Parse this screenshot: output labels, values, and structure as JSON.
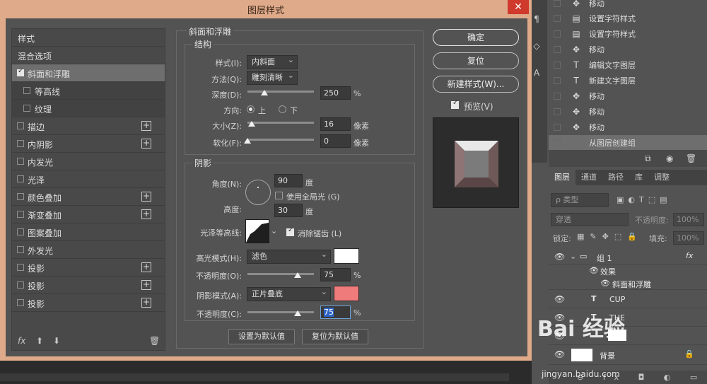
{
  "dialog": {
    "title": "图层样式",
    "close_glyph": "✕"
  },
  "style_list": {
    "header": "样式",
    "blend": "混合选项",
    "items": [
      {
        "label": "斜面和浮雕",
        "checked": true,
        "active": true,
        "plus": false,
        "indent": false
      },
      {
        "label": "等高线",
        "checked": false,
        "active": false,
        "plus": false,
        "indent": true
      },
      {
        "label": "纹理",
        "checked": false,
        "active": false,
        "plus": false,
        "indent": true
      },
      {
        "label": "描边",
        "checked": false,
        "plus": true
      },
      {
        "label": "内阴影",
        "checked": false,
        "plus": true
      },
      {
        "label": "内发光",
        "checked": false,
        "plus": false
      },
      {
        "label": "光泽",
        "checked": false,
        "plus": false
      },
      {
        "label": "颜色叠加",
        "checked": false,
        "plus": true
      },
      {
        "label": "渐变叠加",
        "checked": false,
        "plus": true
      },
      {
        "label": "图案叠加",
        "checked": false,
        "plus": false
      },
      {
        "label": "外发光",
        "checked": false,
        "plus": false
      },
      {
        "label": "投影",
        "checked": false,
        "plus": true
      },
      {
        "label": "投影",
        "checked": false,
        "plus": true
      },
      {
        "label": "投影",
        "checked": false,
        "plus": true
      }
    ],
    "plus_glyph": "+",
    "bottom": {
      "fx": "fx",
      "up": "⬆",
      "down": "⬇",
      "trash": "🗑"
    }
  },
  "bevel": {
    "section": "斜面和浮雕",
    "structure": "结构",
    "style_label": "样式(I):",
    "style_value": "内斜面",
    "technique_label": "方法(Q):",
    "technique_value": "雕刻清晰",
    "depth_label": "深度(D):",
    "depth_value": "250",
    "depth_unit": "%",
    "depth_fraction": 0.25,
    "direction_label": "方向:",
    "dir_up": "上",
    "dir_down": "下",
    "size_label": "大小(Z):",
    "size_value": "16",
    "size_unit": "像素",
    "size_fraction": 0.06,
    "soften_label": "软化(F):",
    "soften_value": "0",
    "soften_unit": "像素",
    "soften_fraction": 0.0
  },
  "shading": {
    "section": "阴影",
    "angle_label": "角度(N):",
    "angle_value": "90",
    "angle_unit": "度",
    "global_light": "使用全局光 (G)",
    "altitude_label": "高度:",
    "altitude_value": "30",
    "altitude_unit": "度",
    "gloss_label": "光泽等高线:",
    "antialias": "消除锯齿 (L)",
    "highlight_label": "高光模式(H):",
    "highlight_value": "滤色",
    "highlight_color": "#ffffff",
    "hl_opacity_label": "不透明度(O):",
    "hl_opacity_value": "75",
    "hl_opacity_fraction": 0.75,
    "shadow_label": "阴影模式(A):",
    "shadow_value": "正片叠底",
    "shadow_color": "#f07b7b",
    "sh_opacity_label": "不透明度(C):",
    "sh_opacity_value": "75",
    "sh_opacity_fraction": 0.75,
    "pct": "%"
  },
  "defaults": {
    "set": "设置为默认值",
    "reset": "复位为默认值"
  },
  "actions": {
    "ok": "确定",
    "reset": "复位",
    "new_style": "新建样式(W)...",
    "preview": "预览(V)"
  },
  "history": {
    "items": [
      {
        "icon": "move-icon",
        "glyph": "✥",
        "label": "移动"
      },
      {
        "icon": "text-style-icon",
        "glyph": "▤",
        "label": "设置字符样式"
      },
      {
        "icon": "text-style-icon",
        "glyph": "▤",
        "label": "设置字符样式"
      },
      {
        "icon": "move-icon",
        "glyph": "✥",
        "label": "移动"
      },
      {
        "icon": "text-layer-icon",
        "glyph": "T",
        "label": "编辑文字图层"
      },
      {
        "icon": "text-layer-icon",
        "glyph": "T",
        "label": "新建文字图层"
      },
      {
        "icon": "move-icon",
        "glyph": "✥",
        "label": "移动"
      },
      {
        "icon": "move-icon",
        "glyph": "✥",
        "label": "移动"
      },
      {
        "icon": "move-icon",
        "glyph": "✥",
        "label": "移动"
      },
      {
        "icon": "group-icon",
        "glyph": "",
        "label": "从图层创建组"
      }
    ]
  },
  "layers_panel": {
    "tabs": [
      "图层",
      "通道",
      "路径",
      "库",
      "调整"
    ],
    "filter": "ρ 类型",
    "blend": "穿透",
    "opacity_label": "不透明度:",
    "opacity_value": "100%",
    "lock_label": "锁定:",
    "fill_label": "填充:",
    "fill_value": "100%",
    "group_name": "组 1",
    "effects": "效果",
    "bevel_effect": "斜面和浮雕",
    "layer_cup": "CUP",
    "layer_the": "THE",
    "layer_bg": "背景",
    "fx": "fx"
  },
  "watermark": {
    "main": "Bai 经验",
    "sub": "jingyan.baidu.com"
  }
}
